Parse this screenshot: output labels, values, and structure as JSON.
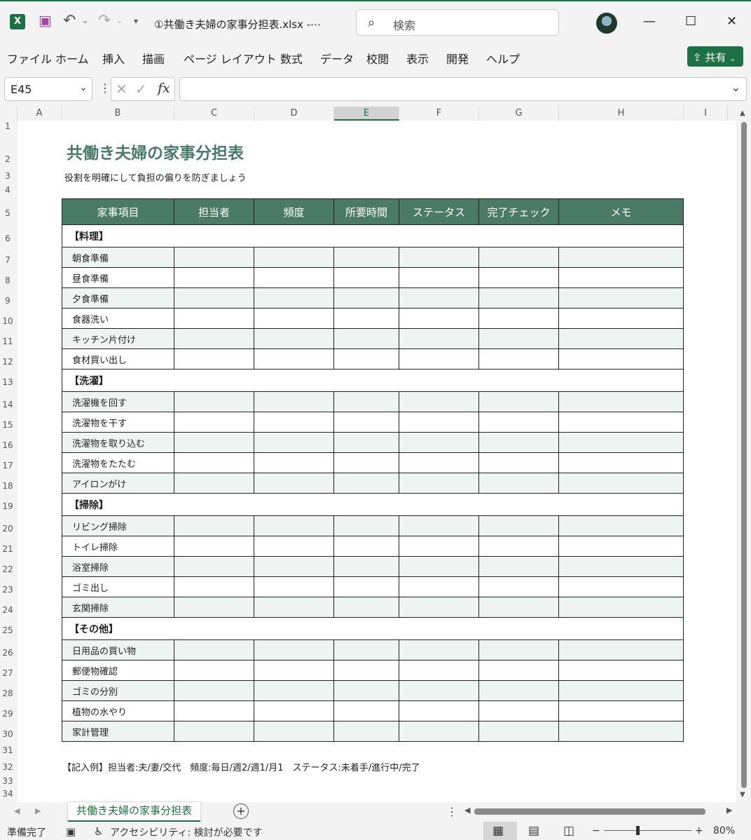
{
  "titlebar": {
    "doc_title": "①共働き夫婦の家事分担表.xlsx  -⋯",
    "search_placeholder": "検索",
    "undo_icon": "undo-icon",
    "redo_icon": "redo-icon"
  },
  "menu": {
    "items": [
      "ファイル",
      "ホーム",
      "挿入",
      "描画",
      "ページ レイアウト",
      "数式",
      "データ",
      "校閲",
      "表示",
      "開発",
      "ヘルプ"
    ],
    "share_label": "共有"
  },
  "formula_bar": {
    "name_box": "E45",
    "fx_label": "fx",
    "formula_value": ""
  },
  "columns": [
    "A",
    "B",
    "C",
    "D",
    "E",
    "F",
    "G",
    "H",
    "I"
  ],
  "selected_column": "E",
  "sheet": {
    "title": "共働き夫婦の家事分担表",
    "subtitle": "役割を明確にして負担の偏りを防ぎましょう",
    "headers": [
      "家事項目",
      "担当者",
      "頻度",
      "所要時間",
      "ステータス",
      "完了チェック",
      "メモ"
    ],
    "categories": [
      {
        "name": "【料理】",
        "items": [
          "朝食準備",
          "昼食準備",
          "夕食準備",
          "食器洗い",
          "キッチン片付け",
          "食材買い出し"
        ]
      },
      {
        "name": "【洗濯】",
        "items": [
          "洗濯機を回す",
          "洗濯物を干す",
          "洗濯物を取り込む",
          "洗濯物をたたむ",
          "アイロンがけ"
        ]
      },
      {
        "name": "【掃除】",
        "items": [
          "リビング掃除",
          "トイレ掃除",
          "浴室掃除",
          "ゴミ出し",
          "玄関掃除"
        ]
      },
      {
        "name": "【その他】",
        "items": [
          "日用品の買い物",
          "郵便物確認",
          "ゴミの分別",
          "植物の水やり",
          "家計管理"
        ]
      }
    ],
    "footnote": "【記入例】担当者:夫/妻/交代　頻度:毎日/週2/週1/月1　ステータス:未着手/進行中/完了",
    "header_color": "#4a7b68",
    "shade_color": "#eef4f1"
  },
  "rows": [
    "1",
    "2",
    "3",
    "4",
    "5",
    "6",
    "7",
    "8",
    "9",
    "10",
    "11",
    "12",
    "13",
    "14",
    "15",
    "16",
    "17",
    "18",
    "19",
    "20",
    "21",
    "22",
    "23",
    "24",
    "25",
    "26",
    "27",
    "28",
    "29",
    "30",
    "31",
    "32",
    "33",
    "34"
  ],
  "tabs": {
    "active": "共働き夫婦の家事分担表",
    "add_label": "+"
  },
  "status": {
    "ready": "準備完了",
    "accessibility": "アクセシビリティ: 検討が必要です",
    "zoom": "80%"
  }
}
